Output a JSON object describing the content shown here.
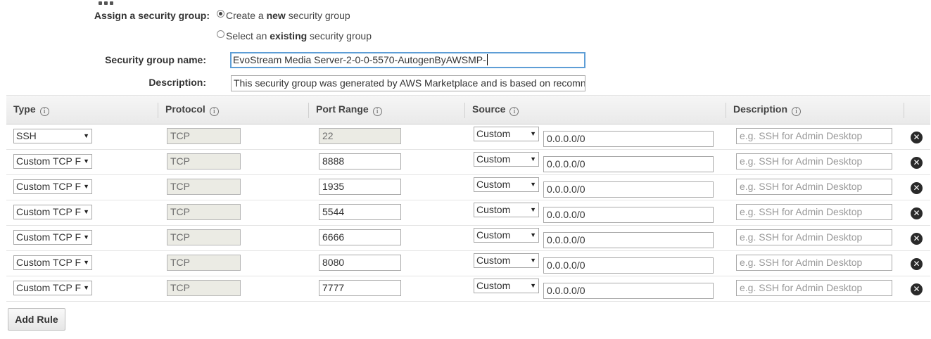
{
  "form": {
    "assign_label": "Assign a security group:",
    "radio_create": {
      "prefix": "Create a ",
      "bold": "new",
      "suffix": " security group"
    },
    "radio_existing": {
      "prefix": "Select an ",
      "bold": "existing",
      "suffix": " security group"
    },
    "name_label": "Security group name:",
    "name_value": "EvoStream Media Server-2-0-0-5570-AutogenByAWSMP-",
    "description_label": "Description:",
    "description_value": "This security group was generated by AWS Marketplace and is based on recomn"
  },
  "table": {
    "headers": {
      "type": "Type",
      "protocol": "Protocol",
      "port_range": "Port Range",
      "source": "Source",
      "description": "Description"
    },
    "info_icon_glyph": "i",
    "description_placeholder": "e.g. SSH for Admin Desktop",
    "rows": [
      {
        "type": "SSH",
        "protocol": "TCP",
        "port": "22",
        "source_type": "Custom",
        "cidr": "0.0.0.0/0"
      },
      {
        "type": "Custom TCP F",
        "protocol": "TCP",
        "port": "8888",
        "source_type": "Custom",
        "cidr": "0.0.0.0/0"
      },
      {
        "type": "Custom TCP F",
        "protocol": "TCP",
        "port": "1935",
        "source_type": "Custom",
        "cidr": "0.0.0.0/0"
      },
      {
        "type": "Custom TCP F",
        "protocol": "TCP",
        "port": "5544",
        "source_type": "Custom",
        "cidr": "0.0.0.0/0"
      },
      {
        "type": "Custom TCP F",
        "protocol": "TCP",
        "port": "6666",
        "source_type": "Custom",
        "cidr": "0.0.0.0/0"
      },
      {
        "type": "Custom TCP F",
        "protocol": "TCP",
        "port": "8080",
        "source_type": "Custom",
        "cidr": "0.0.0.0/0"
      },
      {
        "type": "Custom TCP F",
        "protocol": "TCP",
        "port": "7777",
        "source_type": "Custom",
        "cidr": "0.0.0.0/0"
      }
    ]
  },
  "icons": {
    "dropdown_caret": "▼",
    "remove": "✕",
    "info": "info-icon",
    "radio": "radio-icon"
  },
  "add_rule_label": "Add Rule",
  "colors": {
    "focus_border": "#5e9ed6",
    "header_bg": "#eeeeee",
    "readonly_bg": "#ebebe4"
  }
}
